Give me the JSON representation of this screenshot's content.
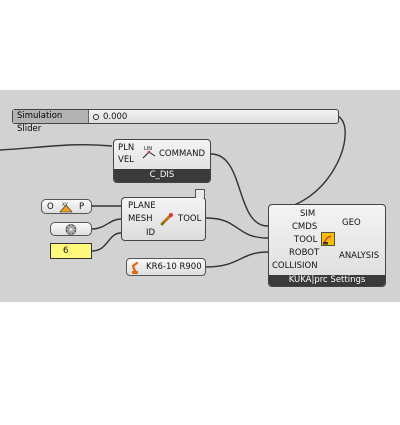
{
  "slider": {
    "label": "Simulation Slider",
    "value": "0.000"
  },
  "c_dis": {
    "inputs": [
      "PLN",
      "VEL"
    ],
    "output": "COMMAND",
    "footer": "C_DIS"
  },
  "tool": {
    "inputs": [
      "PLANE",
      "MESH",
      "ID"
    ],
    "output": "TOOL"
  },
  "plane_param": {
    "left": "O",
    "right": "P"
  },
  "number_panel": {
    "value": "6"
  },
  "robot_param": {
    "label": "KR6-10 R900"
  },
  "kuka": {
    "inputs": [
      "SIM",
      "CMDS",
      "TOOL",
      "ROBOT",
      "COLLISION"
    ],
    "outputs": [
      "GEO",
      "ANALYSIS"
    ],
    "footer": "KUKA|prc Settings"
  },
  "colors": {
    "canvas": "#d2d2d2",
    "wire": "#333333",
    "panel_yellow": "#fff87a",
    "footer": "#3a3a3a"
  }
}
